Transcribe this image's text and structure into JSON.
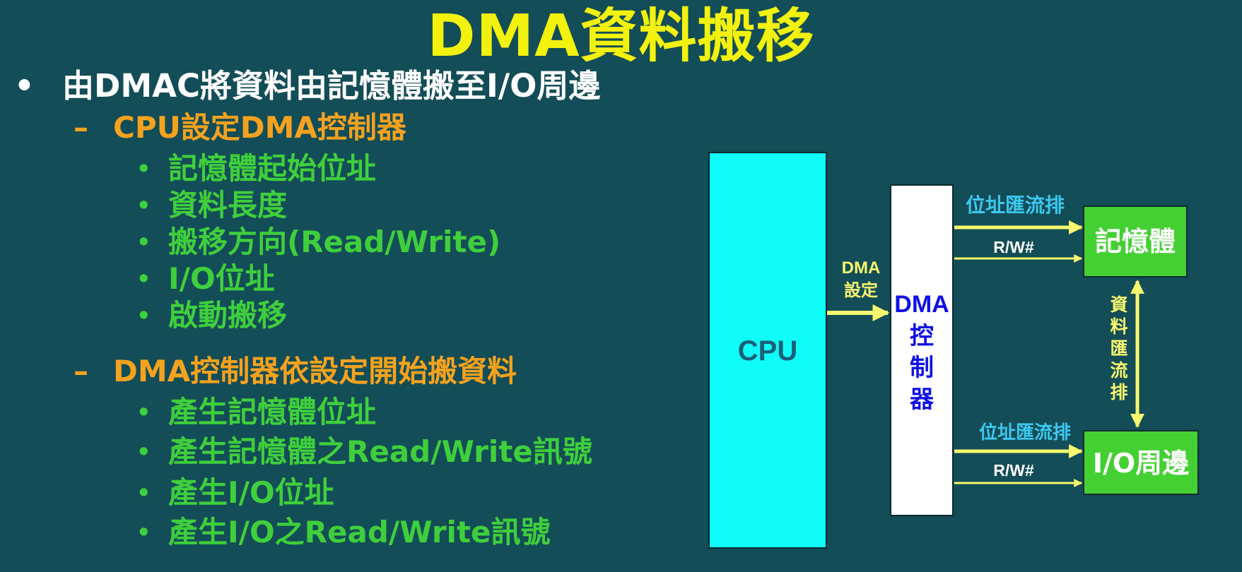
{
  "title": "DMA資料搬移",
  "bullet_marks": {
    "level1": "•",
    "level2": "–",
    "level3": "•"
  },
  "outline": {
    "main": "由DMAC將資料由記憶體搬至I/O周邊",
    "section1": {
      "heading": "CPU設定DMA控制器",
      "items": [
        "記憶體起始位址",
        "資料長度",
        "搬移方向(Read/Write)",
        "I/O位址",
        "啟動搬移"
      ]
    },
    "section2": {
      "heading": "DMA控制器依設定開始搬資料",
      "items": [
        "產生記憶體位址",
        "產生記憶體之Read/Write訊號",
        "產生I/O位址",
        "產生I/O之Read/Write訊號"
      ]
    }
  },
  "diagram": {
    "cpu_label": "CPU",
    "dma_setup_label": [
      "DMA",
      "設定"
    ],
    "dma_controller_label": [
      "DMA",
      "控",
      "制",
      "器"
    ],
    "memory_label": "記憶體",
    "io_label": "I/O周邊",
    "address_bus_label": "位址匯流排",
    "rw_label": "R/W#",
    "data_bus_label": [
      "資",
      "料",
      "匯",
      "流",
      "排"
    ]
  },
  "colors": {
    "background": "#134d57",
    "title": "#f2f20e",
    "level1": "#ffffff",
    "level2": "#f5a21e",
    "level3": "#3fcf3c",
    "cpu_box": "#0ffcf8",
    "cpu_text": "#1b5f7a",
    "dma_box": "#ffffff",
    "dma_text": "#1010e6",
    "device_box": "#44d033",
    "arrow": "#f8f86e",
    "bus_label": "#3cc8f0"
  }
}
